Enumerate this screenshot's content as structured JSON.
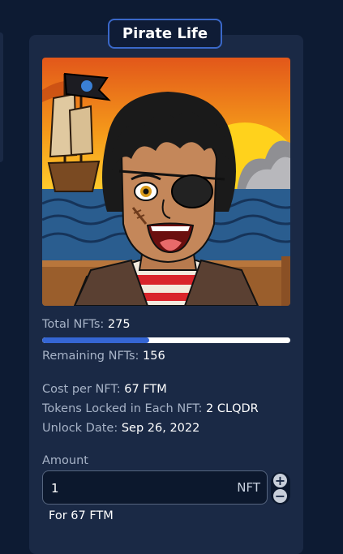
{
  "card": {
    "title": "Pirate Life",
    "image_alt": "Pirate NFT artwork"
  },
  "stats": {
    "total_label": "Total NFTs:",
    "total_value": "275",
    "remaining_label": "Remaining NFTs:",
    "remaining_value": "156",
    "minted_fraction": 0.4327
  },
  "details": {
    "cost_label": "Cost per NFT:",
    "cost_value": "67 FTM",
    "tokens_label": "Tokens Locked in Each NFT:",
    "tokens_value": "2 CLQDR",
    "unlock_label": "Unlock Date:",
    "unlock_value": "Sep 26, 2022"
  },
  "purchase": {
    "amount_label": "Amount",
    "amount_value": "1",
    "amount_unit": "NFT",
    "increment_glyph": "+",
    "decrement_glyph": "−",
    "for_text": "For 67 FTM"
  },
  "colors": {
    "page_bg": "#0d1b33",
    "card_bg": "#1a2945",
    "accent": "#3566d4",
    "muted_text": "#a7b3c7"
  }
}
